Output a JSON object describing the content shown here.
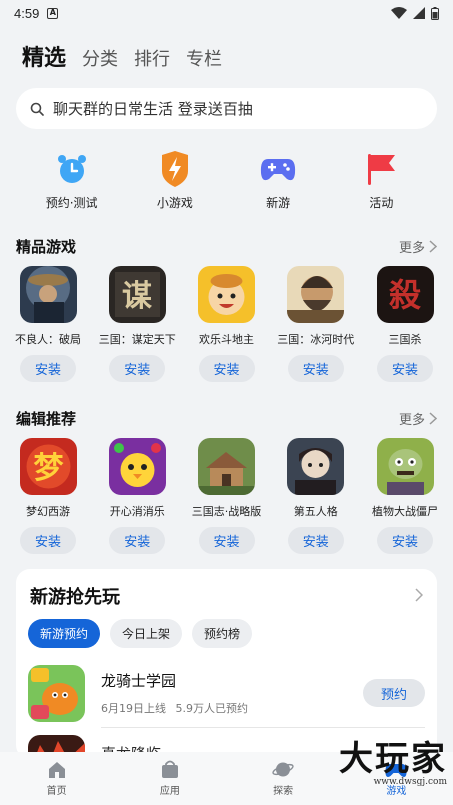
{
  "status_bar": {
    "time": "4:59",
    "notif_letter": "A"
  },
  "top_tabs": [
    "精选",
    "分类",
    "排行",
    "专栏"
  ],
  "search": {
    "text": "聊天群的日常生活 登录送百抽"
  },
  "quick_links": [
    {
      "label": "预约·测试",
      "icon": "alarm-clock-icon",
      "color": "#3fa6f5"
    },
    {
      "label": "小游戏",
      "icon": "lightning-shield-icon",
      "color": "#f08a24"
    },
    {
      "label": "新游",
      "icon": "gamepad-icon",
      "color": "#5b6ef0"
    },
    {
      "label": "活动",
      "icon": "flag-icon",
      "color": "#ef3b45"
    }
  ],
  "featured": {
    "title": "精品游戏",
    "more": "更多",
    "apps": [
      {
        "name": "不良人：破局",
        "install": "安装"
      },
      {
        "name": "三国：谋定天下",
        "install": "安装"
      },
      {
        "name": "欢乐斗地主",
        "install": "安装"
      },
      {
        "name": "三国：冰河时代",
        "install": "安装"
      },
      {
        "name": "三国杀",
        "install": "安装"
      }
    ]
  },
  "editor": {
    "title": "编辑推荐",
    "more": "更多",
    "apps": [
      {
        "name": "梦幻西游",
        "install": "安装"
      },
      {
        "name": "开心消消乐",
        "install": "安装"
      },
      {
        "name": "三国志·战略版",
        "install": "安装"
      },
      {
        "name": "第五人格",
        "install": "安装"
      },
      {
        "name": "植物大战僵尸",
        "install": "安装"
      }
    ]
  },
  "new_games": {
    "title": "新游抢先玩",
    "chips": [
      "新游预约",
      "今日上架",
      "预约榜"
    ],
    "game": {
      "name": "龙骑士学园",
      "date": "6月19日上线",
      "count": "5.9万人已预约",
      "action": "预约"
    },
    "next_name": "真龙降临"
  },
  "bottom_nav": [
    {
      "label": "首页",
      "icon": "home-icon"
    },
    {
      "label": "应用",
      "icon": "bag-icon"
    },
    {
      "label": "探索",
      "icon": "planet-icon"
    },
    {
      "label": "游戏",
      "icon": "game-icon"
    }
  ],
  "watermark": {
    "brand": "大玩家",
    "url": "www.dwsgj.com"
  },
  "colors": {
    "accent": "#1565d8",
    "bg": "#f1f3f5"
  }
}
